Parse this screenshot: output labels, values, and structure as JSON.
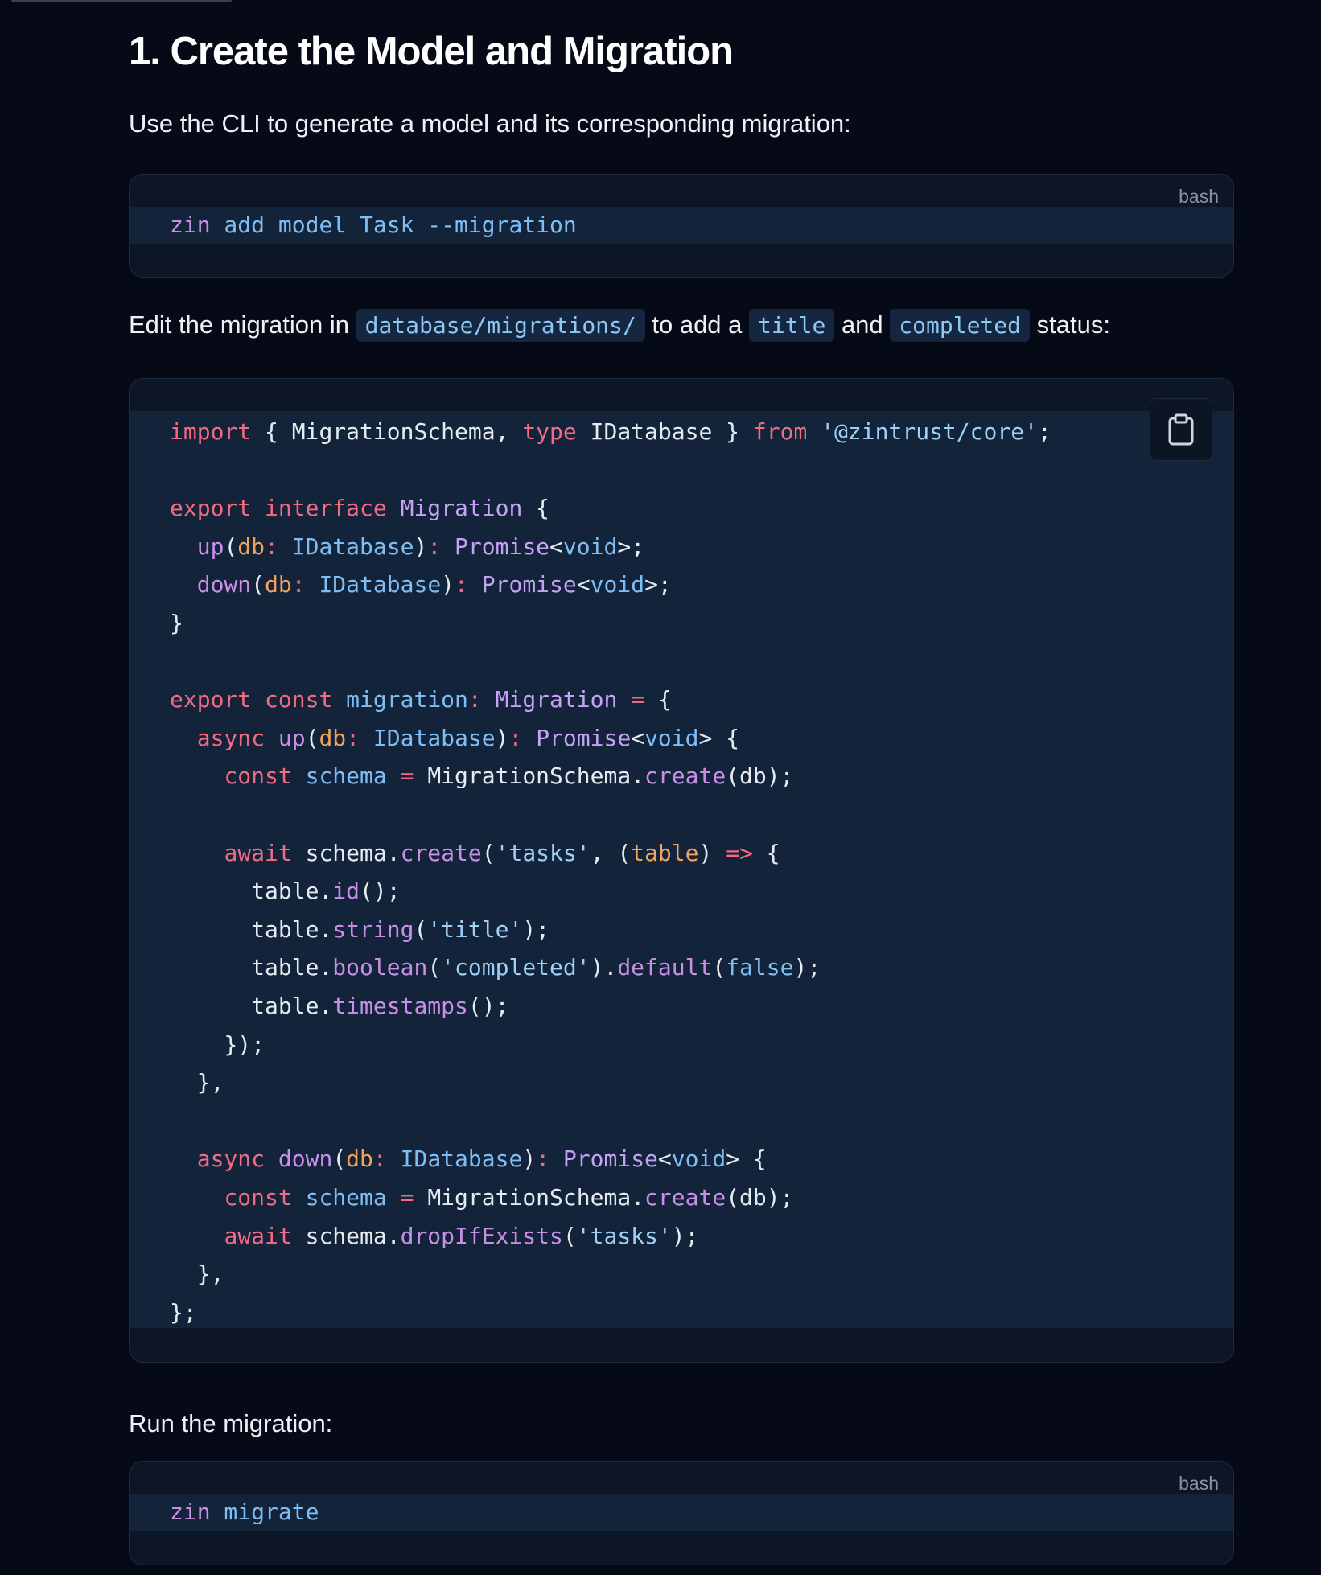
{
  "section": {
    "heading": "1. Create the Model and Migration",
    "intro": "Use the CLI to generate a model and its corresponding migration:"
  },
  "cli_block": {
    "language": "bash",
    "command_tool": "zin",
    "command_rest": " add model Task --migration"
  },
  "edit_paragraph": {
    "text1": "Edit the migration in ",
    "code1": "database/migrations/",
    "text2": " to add a ",
    "code2": "title",
    "text3": " and ",
    "code3": "completed",
    "text4": " status:"
  },
  "migration_code": {
    "copy_icon": "clipboard-icon",
    "lines": [
      [
        [
          "kw",
          "import"
        ],
        [
          "pl",
          " { MigrationSchema, "
        ],
        [
          "kw",
          "type"
        ],
        [
          "pl",
          " IDatabase } "
        ],
        [
          "kw",
          "from"
        ],
        [
          "pl",
          " "
        ],
        [
          "st",
          "'@zintrust/core'"
        ],
        [
          "pl",
          ";"
        ]
      ],
      [],
      [
        [
          "kw",
          "export"
        ],
        [
          "pl",
          " "
        ],
        [
          "kw",
          "interface"
        ],
        [
          "pl",
          " "
        ],
        [
          "ty",
          "Migration"
        ],
        [
          "pl",
          " {"
        ]
      ],
      [
        [
          "pl",
          "  "
        ],
        [
          "fn",
          "up"
        ],
        [
          "pl",
          "("
        ],
        [
          "pa",
          "db"
        ],
        [
          "op",
          ":"
        ],
        [
          "pl",
          " "
        ],
        [
          "id",
          "IDatabase"
        ],
        [
          "pl",
          ")"
        ],
        [
          "op",
          ":"
        ],
        [
          "pl",
          " "
        ],
        [
          "ty",
          "Promise"
        ],
        [
          "pl",
          "<"
        ],
        [
          "id",
          "void"
        ],
        [
          "pl",
          ">;"
        ]
      ],
      [
        [
          "pl",
          "  "
        ],
        [
          "fn",
          "down"
        ],
        [
          "pl",
          "("
        ],
        [
          "pa",
          "db"
        ],
        [
          "op",
          ":"
        ],
        [
          "pl",
          " "
        ],
        [
          "id",
          "IDatabase"
        ],
        [
          "pl",
          ")"
        ],
        [
          "op",
          ":"
        ],
        [
          "pl",
          " "
        ],
        [
          "ty",
          "Promise"
        ],
        [
          "pl",
          "<"
        ],
        [
          "id",
          "void"
        ],
        [
          "pl",
          ">;"
        ]
      ],
      [
        [
          "pl",
          "}"
        ]
      ],
      [],
      [
        [
          "kw",
          "export"
        ],
        [
          "pl",
          " "
        ],
        [
          "kw",
          "const"
        ],
        [
          "pl",
          " "
        ],
        [
          "id",
          "migration"
        ],
        [
          "op",
          ":"
        ],
        [
          "pl",
          " "
        ],
        [
          "ty",
          "Migration"
        ],
        [
          "pl",
          " "
        ],
        [
          "op",
          "="
        ],
        [
          "pl",
          " {"
        ]
      ],
      [
        [
          "pl",
          "  "
        ],
        [
          "kw",
          "async"
        ],
        [
          "pl",
          " "
        ],
        [
          "fn",
          "up"
        ],
        [
          "pl",
          "("
        ],
        [
          "pa",
          "db"
        ],
        [
          "op",
          ":"
        ],
        [
          "pl",
          " "
        ],
        [
          "id",
          "IDatabase"
        ],
        [
          "pl",
          ")"
        ],
        [
          "op",
          ":"
        ],
        [
          "pl",
          " "
        ],
        [
          "ty",
          "Promise"
        ],
        [
          "pl",
          "<"
        ],
        [
          "id",
          "void"
        ],
        [
          "pl",
          "> {"
        ]
      ],
      [
        [
          "pl",
          "    "
        ],
        [
          "kw",
          "const"
        ],
        [
          "pl",
          " "
        ],
        [
          "id",
          "schema"
        ],
        [
          "pl",
          " "
        ],
        [
          "op",
          "="
        ],
        [
          "pl",
          " MigrationSchema."
        ],
        [
          "fn",
          "create"
        ],
        [
          "pl",
          "(db);"
        ]
      ],
      [],
      [
        [
          "pl",
          "    "
        ],
        [
          "kw",
          "await"
        ],
        [
          "pl",
          " schema."
        ],
        [
          "fn",
          "create"
        ],
        [
          "pl",
          "("
        ],
        [
          "st",
          "'tasks'"
        ],
        [
          "pl",
          ", ("
        ],
        [
          "pa",
          "table"
        ],
        [
          "pl",
          ") "
        ],
        [
          "op",
          "=>"
        ],
        [
          "pl",
          " {"
        ]
      ],
      [
        [
          "pl",
          "      table."
        ],
        [
          "fn",
          "id"
        ],
        [
          "pl",
          "();"
        ]
      ],
      [
        [
          "pl",
          "      table."
        ],
        [
          "fn",
          "string"
        ],
        [
          "pl",
          "("
        ],
        [
          "st",
          "'title'"
        ],
        [
          "pl",
          ");"
        ]
      ],
      [
        [
          "pl",
          "      table."
        ],
        [
          "fn",
          "boolean"
        ],
        [
          "pl",
          "("
        ],
        [
          "st",
          "'completed'"
        ],
        [
          "pl",
          ")."
        ],
        [
          "fn",
          "default"
        ],
        [
          "pl",
          "("
        ],
        [
          "id",
          "false"
        ],
        [
          "pl",
          ");"
        ]
      ],
      [
        [
          "pl",
          "      table."
        ],
        [
          "fn",
          "timestamps"
        ],
        [
          "pl",
          "();"
        ]
      ],
      [
        [
          "pl",
          "    });"
        ]
      ],
      [
        [
          "pl",
          "  },"
        ]
      ],
      [],
      [
        [
          "pl",
          "  "
        ],
        [
          "kw",
          "async"
        ],
        [
          "pl",
          " "
        ],
        [
          "fn",
          "down"
        ],
        [
          "pl",
          "("
        ],
        [
          "pa",
          "db"
        ],
        [
          "op",
          ":"
        ],
        [
          "pl",
          " "
        ],
        [
          "id",
          "IDatabase"
        ],
        [
          "pl",
          ")"
        ],
        [
          "op",
          ":"
        ],
        [
          "pl",
          " "
        ],
        [
          "ty",
          "Promise"
        ],
        [
          "pl",
          "<"
        ],
        [
          "id",
          "void"
        ],
        [
          "pl",
          "> {"
        ]
      ],
      [
        [
          "pl",
          "    "
        ],
        [
          "kw",
          "const"
        ],
        [
          "pl",
          " "
        ],
        [
          "id",
          "schema"
        ],
        [
          "pl",
          " "
        ],
        [
          "op",
          "="
        ],
        [
          "pl",
          " MigrationSchema."
        ],
        [
          "fn",
          "create"
        ],
        [
          "pl",
          "(db);"
        ]
      ],
      [
        [
          "pl",
          "    "
        ],
        [
          "kw",
          "await"
        ],
        [
          "pl",
          " schema."
        ],
        [
          "fn",
          "dropIfExists"
        ],
        [
          "pl",
          "("
        ],
        [
          "st",
          "'tasks'"
        ],
        [
          "pl",
          ");"
        ]
      ],
      [
        [
          "pl",
          "  },"
        ]
      ],
      [
        [
          "pl",
          "};"
        ]
      ]
    ]
  },
  "run_section": {
    "text": "Run the migration:"
  },
  "run_block": {
    "language": "bash",
    "command_tool": "zin",
    "command_rest": " migrate"
  },
  "colors": {
    "background": "#050a16",
    "code_background": "#12233a",
    "keyword": "#f26b83",
    "function": "#c98fe8",
    "identifier": "#7fbef5",
    "type": "#c5a2f5",
    "parameter": "#f2a35b",
    "string": "#9fd0f7"
  }
}
